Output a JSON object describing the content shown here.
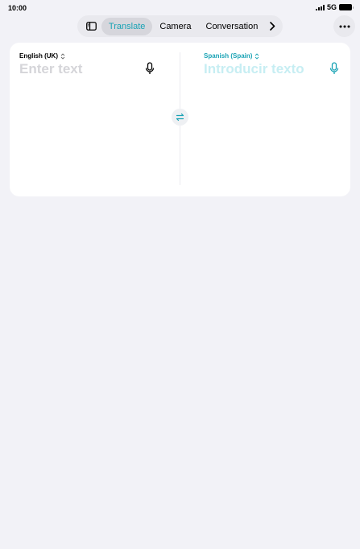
{
  "status": {
    "time": "10:00",
    "network": "5G"
  },
  "tabs": [
    {
      "label": "Translate",
      "active": true
    },
    {
      "label": "Camera",
      "active": false
    },
    {
      "label": "Conversation",
      "active": false
    }
  ],
  "source": {
    "language": "English (UK)",
    "placeholder": "Enter text"
  },
  "target": {
    "language": "Spanish (Spain)",
    "placeholder": "Introducir texto"
  },
  "colors": {
    "accent": "#1aa3b5",
    "background": "#f2f2f7",
    "card": "#ffffff"
  },
  "icons": {
    "sidebar": "sidebar-icon",
    "more": "ellipsis-icon",
    "chevron": "chevron-right-icon",
    "mic": "microphone-icon",
    "swap": "swap-arrows-icon"
  }
}
